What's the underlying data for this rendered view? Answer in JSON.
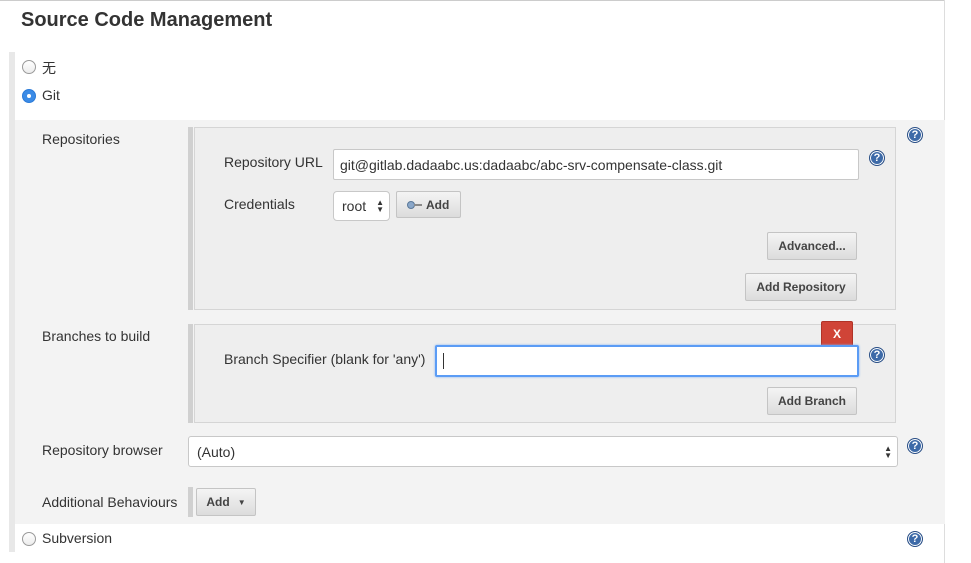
{
  "section": {
    "title": "Source Code Management"
  },
  "scm_options": {
    "none_label": "无",
    "git_label": "Git",
    "svn_label": "Subversion"
  },
  "repositories": {
    "label": "Repositories",
    "url_label": "Repository URL",
    "url_value": "git@gitlab.dadaabc.us:dadaabc/abc-srv-compensate-class.git",
    "credentials_label": "Credentials",
    "credentials_value": "root",
    "add_credentials_label": "Add",
    "advanced_label": "Advanced...",
    "add_repository_label": "Add Repository"
  },
  "branches": {
    "label": "Branches to build",
    "delete_label": "X",
    "specifier_label": "Branch Specifier (blank for 'any')",
    "specifier_value": "",
    "add_branch_label": "Add Branch"
  },
  "repo_browser": {
    "label": "Repository browser",
    "value": "(Auto)"
  },
  "behaviours": {
    "label": "Additional Behaviours",
    "add_label": "Add"
  },
  "icons": {
    "help": "help-icon",
    "key": "key-icon",
    "dropdown": "chevron-down-icon"
  },
  "colors": {
    "accent": "#3b8be6",
    "delete": "#d04437",
    "help": "#3d6aa8"
  }
}
